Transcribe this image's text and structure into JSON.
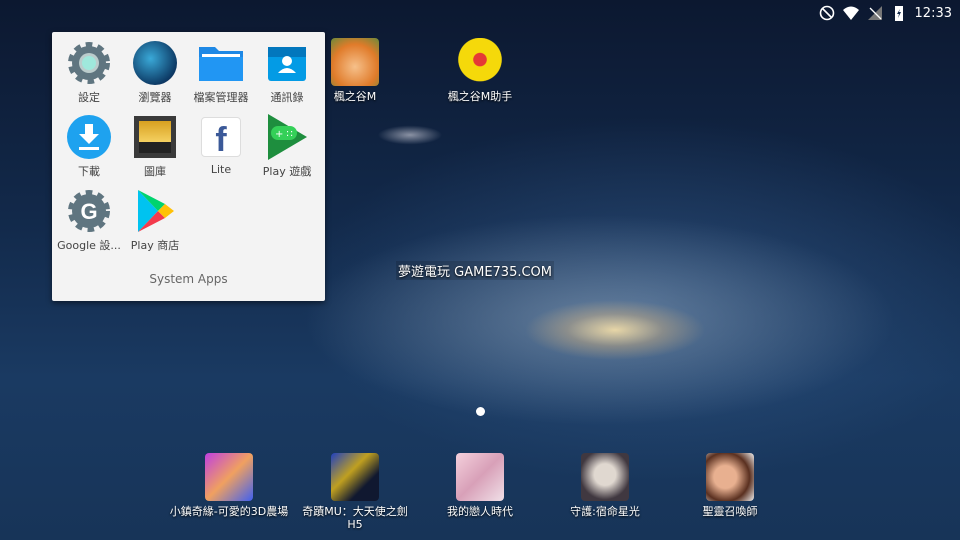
{
  "status_bar": {
    "time": "12:33",
    "icons": [
      "do-not-disturb-icon",
      "wifi-icon",
      "no-signal-icon",
      "battery-charging-icon"
    ]
  },
  "folder": {
    "title": "System Apps",
    "apps": [
      {
        "label": "設定",
        "icon": "settings-icon"
      },
      {
        "label": "瀏覽器",
        "icon": "browser-icon"
      },
      {
        "label": "檔案管理器",
        "icon": "file-manager-icon"
      },
      {
        "label": "通訊錄",
        "icon": "contacts-icon"
      },
      {
        "label": "下載",
        "icon": "download-icon"
      },
      {
        "label": "圖庫",
        "icon": "gallery-icon"
      },
      {
        "label": "Lite",
        "icon": "facebook-lite-icon"
      },
      {
        "label": "Play 遊戲",
        "icon": "play-games-icon"
      },
      {
        "label": "Google 設...",
        "icon": "google-settings-icon"
      },
      {
        "label": "Play 商店",
        "icon": "play-store-icon"
      }
    ]
  },
  "desktop": {
    "apps": [
      {
        "label": "楓之谷M"
      },
      {
        "label": "楓之谷M助手"
      }
    ]
  },
  "watermark": "夢遊電玩 GAME735.COM",
  "dock": {
    "apps": [
      {
        "label": "小鎮奇緣-可愛的3D農場"
      },
      {
        "label": "奇蹟MU：大天使之劍H5"
      },
      {
        "label": "我的戀人時代"
      },
      {
        "label": "守護:宿命星光"
      },
      {
        "label": "聖靈召喚師"
      }
    ]
  },
  "colors": {
    "folder_bg": "#f3f3f3",
    "accent_blue": "#1e88e5"
  }
}
